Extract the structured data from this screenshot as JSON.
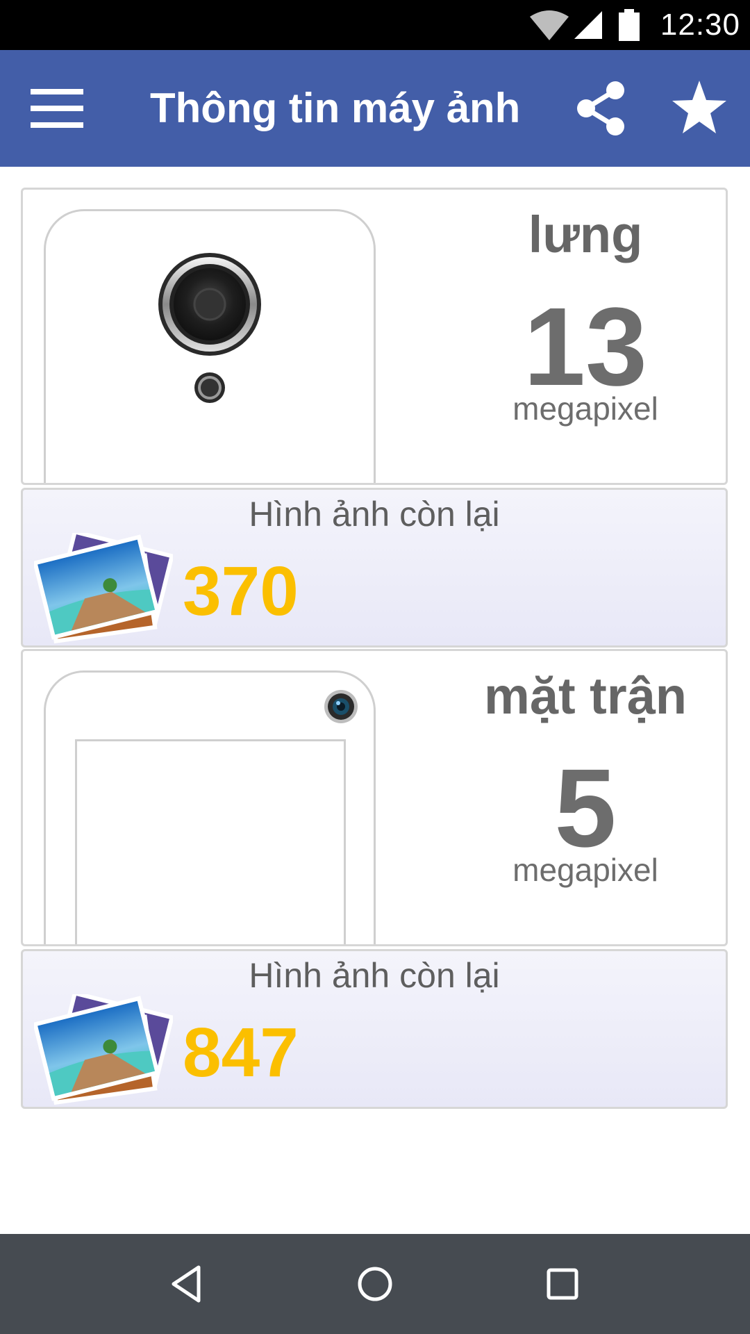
{
  "status_bar": {
    "time": "12:30",
    "icons": [
      "wifi-icon",
      "cell-signal-icon",
      "battery-icon"
    ]
  },
  "app_bar": {
    "title": "Thông tin máy ảnh",
    "icons": [
      "menu-icon",
      "share-icon",
      "star-icon"
    ],
    "background_color": "#435ea8"
  },
  "cameras": [
    {
      "label": "lưng",
      "megapixels": "13",
      "unit": "megapixel",
      "photos_label": "Hình ảnh còn lại",
      "photos_remaining": "370"
    },
    {
      "label": "mặt trận",
      "megapixels": "5",
      "unit": "megapixel",
      "photos_label": "Hình ảnh còn lại",
      "photos_remaining": "847"
    }
  ],
  "colors": {
    "count_accent": "#fbbf00",
    "text_gray": "#6d6d6d",
    "nav_bar": "#464b51"
  },
  "nav_bar": {
    "icons": [
      "back-icon",
      "home-icon",
      "recents-icon"
    ]
  }
}
